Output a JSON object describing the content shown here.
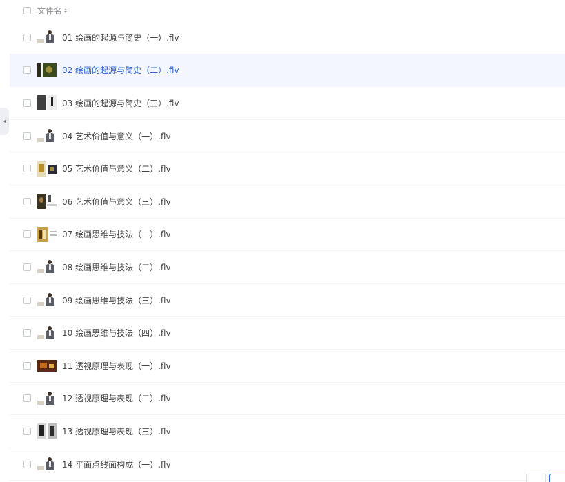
{
  "header": {
    "column_label": "文件名"
  },
  "files": [
    {
      "name": "01 绘画的起源与简史（一）.flv",
      "thumb": "person"
    },
    {
      "name": "02 绘画的起源与简史（二）.flv",
      "thumb": "dark",
      "selected": true
    },
    {
      "name": "03 绘画的起源与简史（三）.flv",
      "thumb": "book"
    },
    {
      "name": "04 艺术价值与意义（一）.flv",
      "thumb": "person"
    },
    {
      "name": "05 艺术价值与意义（二）.flv",
      "thumb": "art"
    },
    {
      "name": "06 艺术价值与意义（三）.flv",
      "thumb": "mona"
    },
    {
      "name": "07 绘画思维与技法（一）.flv",
      "thumb": "gold"
    },
    {
      "name": "08 绘画思维与技法（二）.flv",
      "thumb": "person"
    },
    {
      "name": "09 绘画思维与技法（三）.flv",
      "thumb": "person"
    },
    {
      "name": "10 绘画思维与技法（四）.flv",
      "thumb": "person"
    },
    {
      "name": "11 透视原理与表现（一）.flv",
      "thumb": "red"
    },
    {
      "name": "12 透视原理与表现（二）.flv",
      "thumb": "person"
    },
    {
      "name": "13 透视原理与表现（三）.flv",
      "thumb": "bw"
    },
    {
      "name": "14 平面点线面构成（一）.flv",
      "thumb": "person"
    }
  ],
  "colors": {
    "selected_text": "#2f64d6",
    "selected_bg": "#f3f6fe"
  }
}
